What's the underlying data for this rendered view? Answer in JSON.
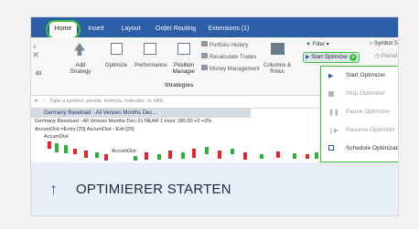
{
  "tabs": [
    "Home",
    "Insert",
    "Layout",
    "Order Routing",
    "Extensions (1)"
  ],
  "ribbon": {
    "left_clip": "dit",
    "add_strategy": "Add Strategy",
    "optimize": "Optimize",
    "performance": "Performance",
    "position_manager": "Position Manager",
    "portfolio_history": "Portfolio History",
    "recalculate_trades": "Recalculate Trades",
    "money_management": "Money Management",
    "columns_rows": "Columns & Rows",
    "strategies_group": "Strategies",
    "filter": "Filter",
    "start_optimizer": "Start Optimizer",
    "period": "Period",
    "symbol": "Symbol S"
  },
  "command_bar": {
    "placeholder": "Type a symbol, period, formula, indicator, or URL"
  },
  "chart": {
    "title": "Germany Baseload - All Venues Months Dec...",
    "subtitle": "Germany Baseload - All Venues Months Dec-21 NEAR  1 Hour  180.00  +0  +0%",
    "line2": "AccumDist =Entry [20]   AccumDist - Exit [20]",
    "line3": "AccumDist",
    "label2": "AccumDist"
  },
  "menu": {
    "items": [
      {
        "label": "Start Optimizer",
        "enabled": true,
        "icon": "play-icon"
      },
      {
        "label": "Stop Optimizer",
        "enabled": false,
        "icon": "stop-icon"
      },
      {
        "label": "Pause Optimizer",
        "enabled": false,
        "icon": "pause-icon"
      },
      {
        "label": "Resume Optimizer",
        "enabled": false,
        "icon": "resume-icon"
      },
      {
        "label": "Schedule Optimization",
        "enabled": true,
        "icon": "schedule-icon"
      }
    ]
  },
  "caption": {
    "arrow": "↑",
    "text": "OPTIMIERER STARTEN"
  },
  "colors": {
    "ribbon_blue": "#2c5ea8",
    "highlight_green": "#3cc23c",
    "caption_bg": "#e9eff8",
    "caption_text": "#1c2b45",
    "candle_up": "#2fae3a",
    "candle_down": "#e0262a"
  }
}
